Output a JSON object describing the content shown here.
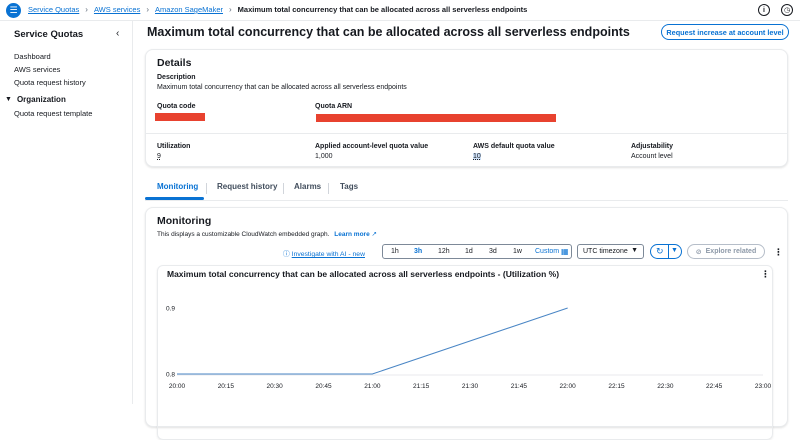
{
  "breadcrumb": {
    "items": [
      "Service Quotas",
      "AWS services",
      "Amazon SageMaker"
    ],
    "current": "Maximum total concurrency that can be allocated across all serverless endpoints"
  },
  "sidebar": {
    "title": "Service Quotas",
    "links": [
      "Dashboard",
      "AWS services",
      "Quota request history"
    ],
    "section": "Organization",
    "section_links": [
      "Quota request template"
    ]
  },
  "page": {
    "title": "Maximum total concurrency that can be allocated across all serverless endpoints",
    "request_button": "Request increase at account level"
  },
  "details": {
    "heading": "Details",
    "description_label": "Description",
    "description": "Maximum total concurrency that can be allocated across all serverless endpoints",
    "quota_code_label": "Quota code",
    "quota_arn_label": "Quota ARN",
    "utilization_label": "Utilization",
    "utilization": "9",
    "applied_label": "Applied account-level quota value",
    "applied": "1,000",
    "default_label": "AWS default quota value",
    "default": "10",
    "adjustability_label": "Adjustability",
    "adjustability": "Account level"
  },
  "tabs": [
    "Monitoring",
    "Request history",
    "Alarms",
    "Tags"
  ],
  "monitoring": {
    "heading": "Monitoring",
    "description": "This displays a customizable CloudWatch embedded graph.",
    "learn_more": "Learn more",
    "investigate": "Investigate with AI - new",
    "ranges": [
      "1h",
      "3h",
      "12h",
      "1d",
      "3d",
      "1w",
      "Custom"
    ],
    "selected_range": "3h",
    "timezone": "UTC timezone",
    "explore": "Explore related"
  },
  "chart_data": {
    "type": "line",
    "title": "Maximum total concurrency that can be allocated across all serverless endpoints - (Utilization %)",
    "x": [
      "20:00",
      "20:15",
      "20:30",
      "20:45",
      "21:00",
      "21:15",
      "21:30",
      "21:45",
      "22:00",
      "22:15",
      "22:30",
      "22:45",
      "23:00"
    ],
    "yticks": [
      0.8,
      0.9
    ],
    "ylim": [
      0.8,
      0.9
    ],
    "series": [
      {
        "points": [
          [
            "20:00",
            0.8
          ],
          [
            "21:00",
            0.8
          ],
          [
            "22:00",
            0.9
          ]
        ]
      }
    ],
    "colors": {
      "line": "#4a86c5"
    }
  },
  "colors": {
    "accent": "#0972d3",
    "redaction": "#e8422f"
  }
}
